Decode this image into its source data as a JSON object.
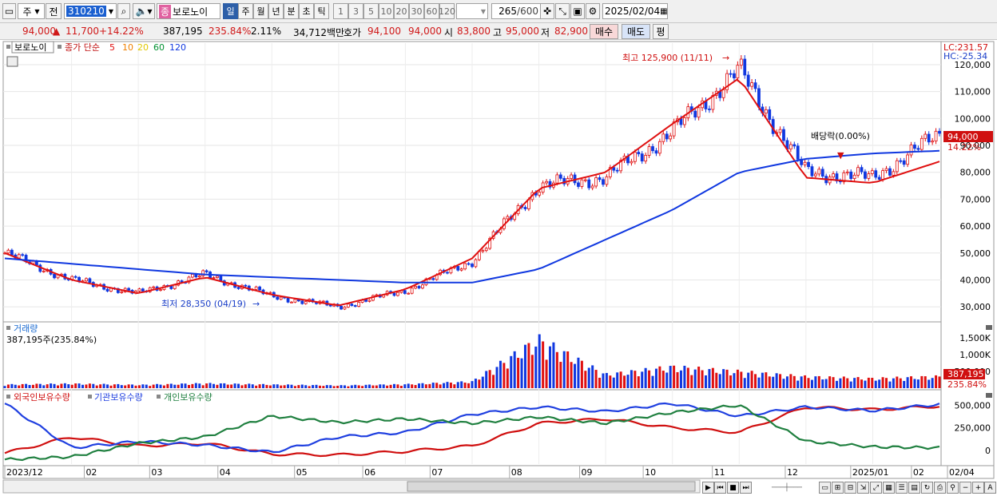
{
  "toolbar": {
    "type_label": "주",
    "prev_label": "전",
    "code": "310210",
    "name_badge": "종",
    "name": "보로노이",
    "periods": [
      "일",
      "주",
      "월",
      "년",
      "분",
      "초",
      "틱"
    ],
    "period_active": 0,
    "intervals": [
      "1",
      "3",
      "5",
      "10",
      "20",
      "30",
      "60",
      "120"
    ],
    "count": "265",
    "count_max": "/600",
    "date": "2025/02/04"
  },
  "quote": {
    "price": "94,000",
    "arrow": "▲",
    "change": "11,700",
    "change_pct": "+14.22%",
    "volume": "387,195",
    "volume_pct": "235.84%",
    "turnover": "2.11%",
    "amount": "34,712백만",
    "bid_label": "호가",
    "bid": "94,100",
    "ask": "94,000",
    "open_label": "시",
    "open": "83,800",
    "high_label": "고",
    "high": "95,000",
    "low_label": "저",
    "low": "82,900",
    "buy_label": "매수",
    "sell_label": "매도",
    "avg_label": "평"
  },
  "price_panel": {
    "name": "보로노이",
    "legend_prefix": "종가 단순",
    "ma": [
      {
        "period": "5",
        "color": "#e01010"
      },
      {
        "period": "10",
        "color": "#f08000"
      },
      {
        "period": "20",
        "color": "#f0e000"
      },
      {
        "period": "60",
        "color": "#009030"
      },
      {
        "period": "120",
        "color": "#1038e0"
      }
    ],
    "lc": "LC:231.57",
    "hc": "HC:-25.34",
    "high_note": "최고 125,900 (11/11)",
    "low_note": "최저 28,350 (04/19)",
    "dividend_note": "배당락(0.00%)",
    "last_price": "94,000",
    "last_pct": "14.22%",
    "y_ticks": [
      "120,000",
      "110,000",
      "100,000",
      "90,000",
      "80,000",
      "70,000",
      "60,000",
      "50,000",
      "40,000",
      "30,000"
    ]
  },
  "volume_panel": {
    "title": "거래량",
    "value": "387,195주(235.84%)",
    "y_ticks": [
      "1,500K",
      "1,000K",
      "500,000"
    ],
    "last": "387,195",
    "last_pct": "235.84%"
  },
  "holdings_panel": {
    "legend": [
      "외국인보유수량",
      "기관보유수량",
      "개인보유수량"
    ],
    "colors": [
      "#d01010",
      "#2040e0",
      "#208040"
    ],
    "y_ticks": [
      "500,000",
      "250,000",
      "0"
    ]
  },
  "x_axis": {
    "labels": [
      "2023/12",
      "02",
      "03",
      "04",
      "05",
      "06",
      "07",
      "08",
      "09",
      "10",
      "11",
      "12",
      "2025/01",
      "02",
      "02/04"
    ]
  },
  "chart_data": {
    "type": "candlestick",
    "title": "보로노이",
    "ylim": [
      25000,
      128000
    ],
    "x": [
      "2023/12",
      "2024/01",
      "2024/02",
      "2024/03",
      "2024/04",
      "2024/05",
      "2024/06",
      "2024/07",
      "2024/08",
      "2024/09",
      "2024/10",
      "2024/11",
      "2024/12",
      "2025/01",
      "2025/02"
    ],
    "close": [
      50000,
      40000,
      35000,
      42000,
      34000,
      30000,
      36000,
      47000,
      75000,
      78000,
      95000,
      118000,
      80000,
      78000,
      94000
    ],
    "ma_close": [
      {
        "name": "5",
        "values": [
          50000,
          40000,
          35000,
          41000,
          34500,
          30500,
          36500,
          48000,
          74000,
          80000,
          98000,
          115000,
          78000,
          76000,
          84000
        ]
      },
      {
        "name": "120",
        "values": [
          48000,
          46000,
          44000,
          42000,
          41000,
          40000,
          39000,
          39000,
          44000,
          55000,
          66000,
          80000,
          85000,
          87000,
          88000
        ]
      }
    ],
    "volume_K": [
      120,
      150,
      110,
      160,
      120,
      90,
      130,
      220,
      1620,
      450,
      700,
      550,
      380,
      320,
      387
    ],
    "holdings": [
      {
        "name": "외국인보유수량",
        "values": [
          -30000,
          150000,
          50000,
          80000,
          -40000,
          -50000,
          -10000,
          50000,
          300000,
          350000,
          250000,
          200000,
          480000,
          450000,
          490000
        ]
      },
      {
        "name": "기관보유수량",
        "values": [
          520000,
          30000,
          100000,
          60000,
          -20000,
          150000,
          200000,
          400000,
          480000,
          430000,
          520000,
          380000,
          480000,
          440000,
          510000
        ]
      },
      {
        "name": "개인보유수량",
        "values": [
          -100000,
          -70000,
          80000,
          150000,
          380000,
          310000,
          350000,
          300000,
          370000,
          300000,
          420000,
          500000,
          100000,
          40000,
          30000
        ]
      }
    ]
  }
}
